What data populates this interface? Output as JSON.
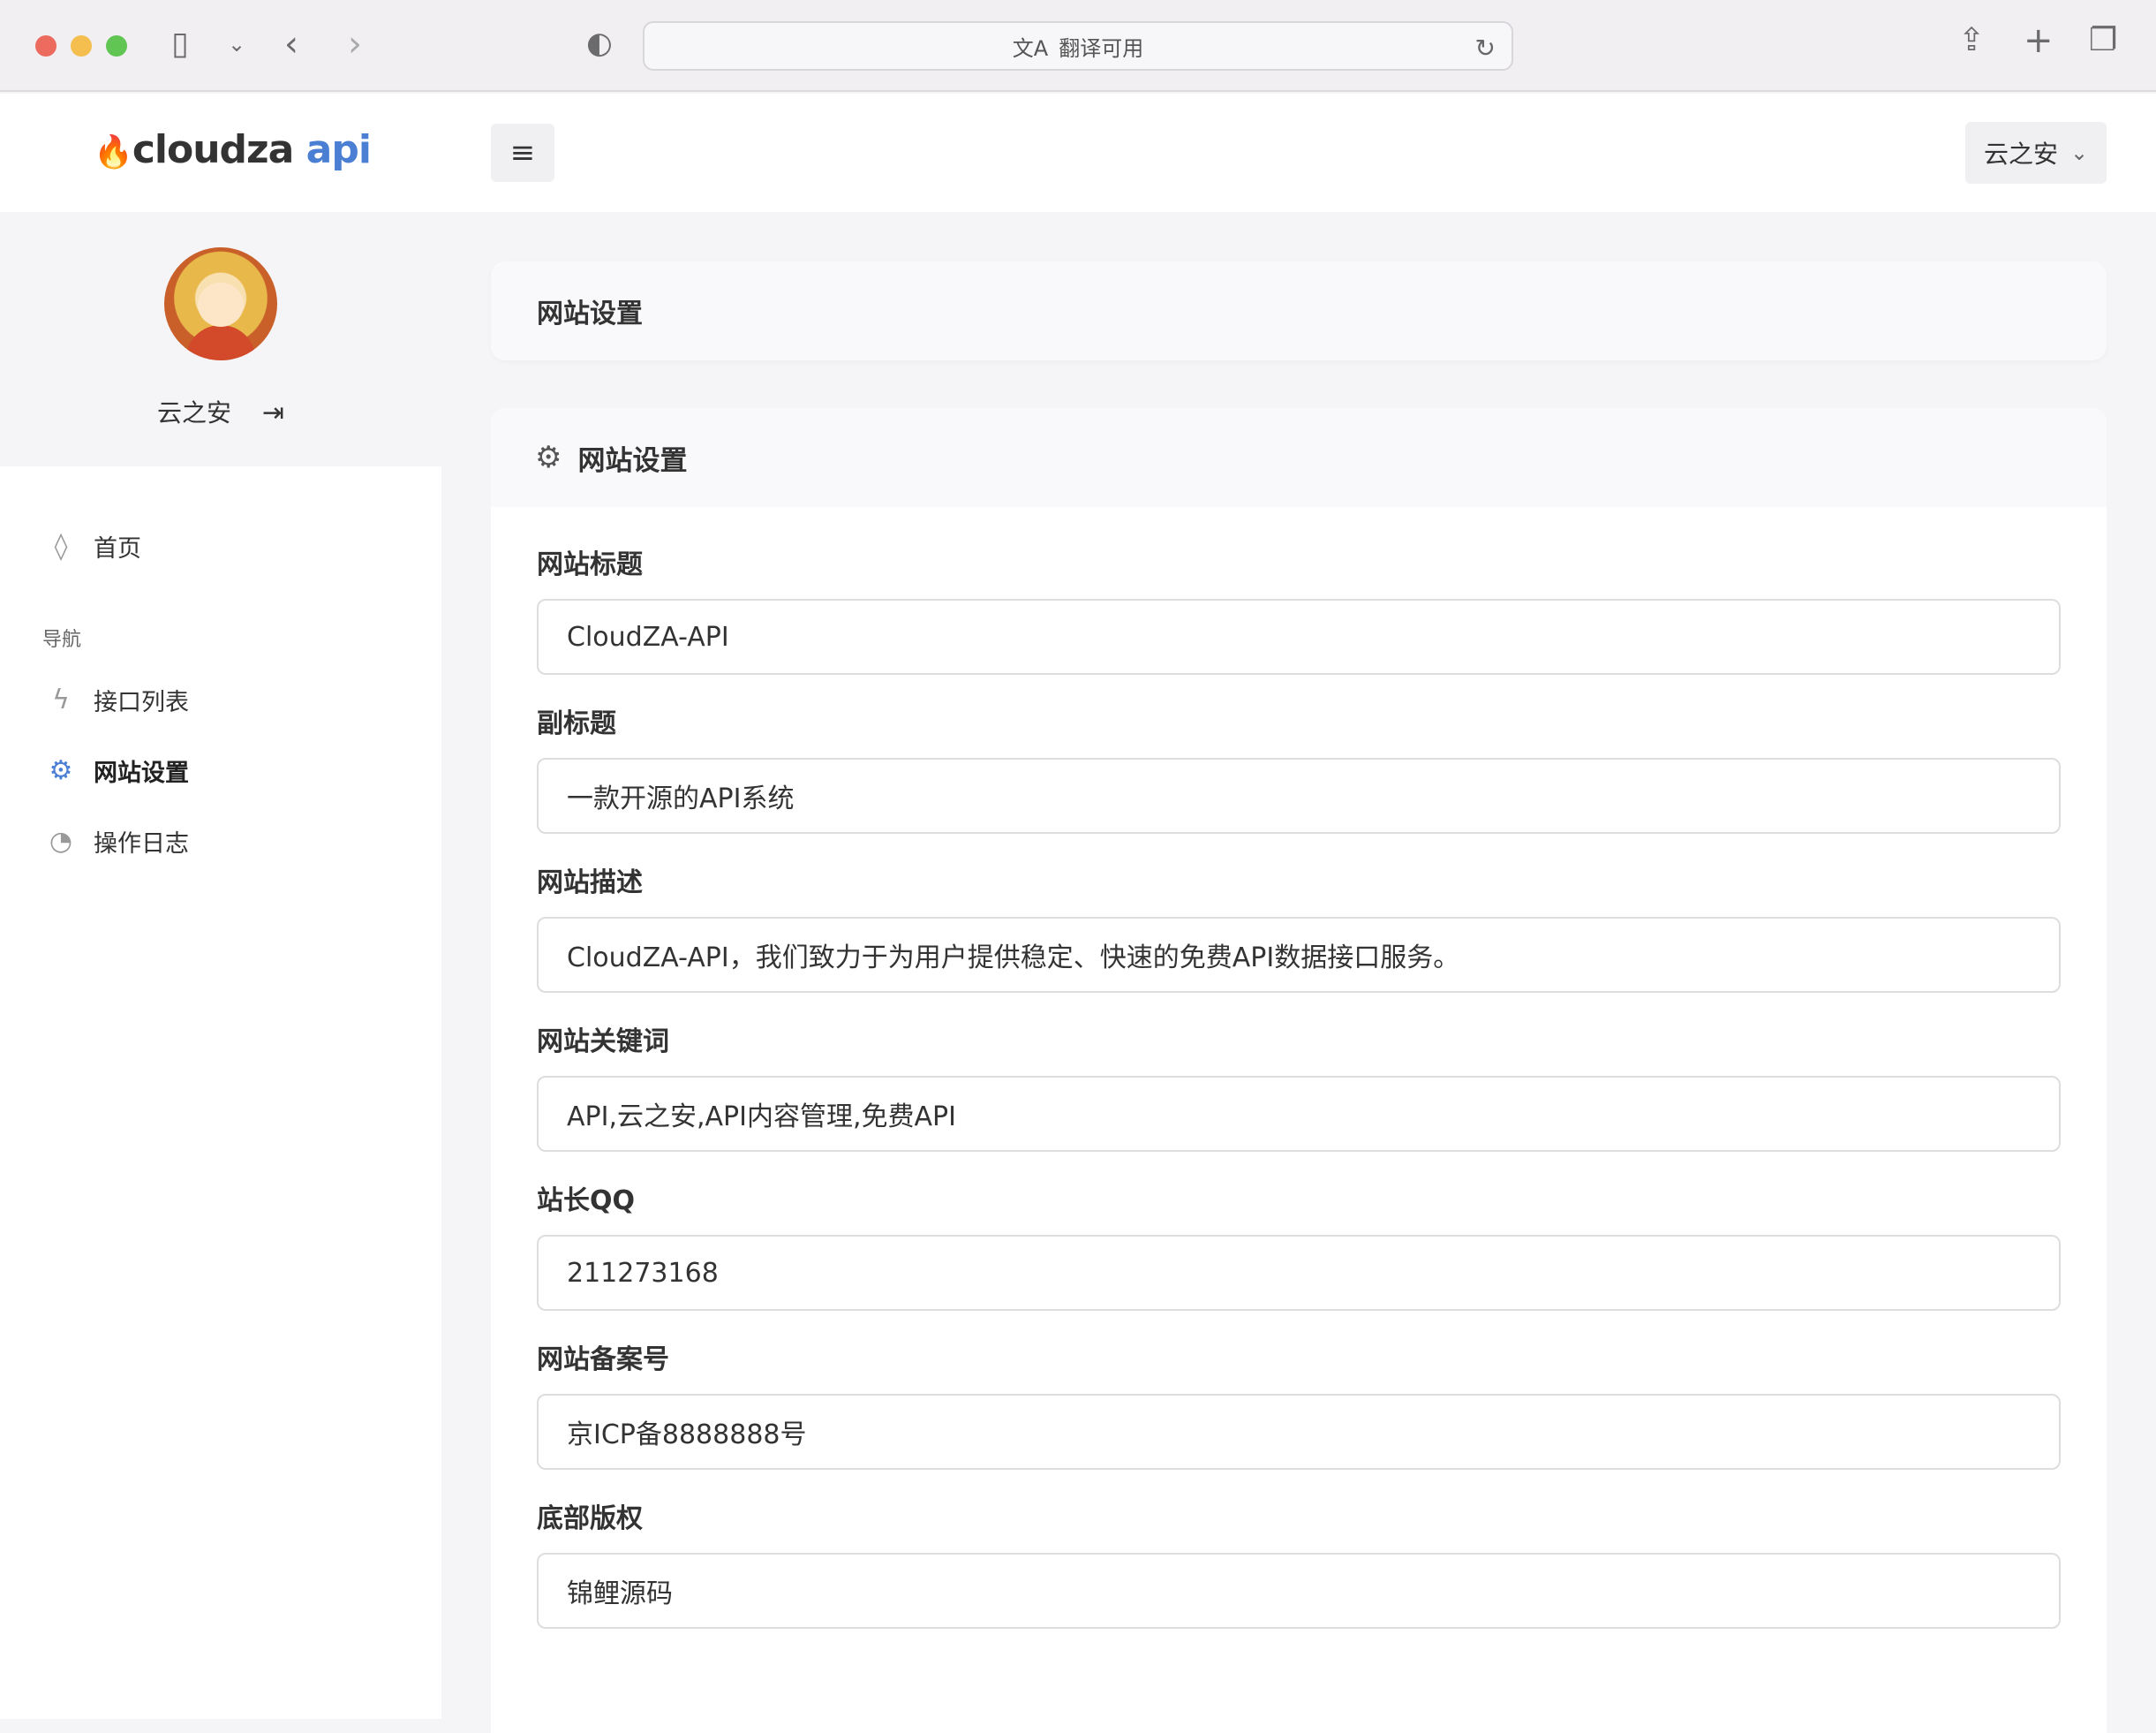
{
  "browser": {
    "url_text": "翻译可用",
    "translate_icon": "translate-icon",
    "reload_icon": "reload-icon"
  },
  "header": {
    "logo_main": "cloudza",
    "logo_accent": "api",
    "menu_icon": "≡",
    "user_name": "云之安",
    "accent_color": "#4a7fd4"
  },
  "sidebar": {
    "profile_name": "云之安",
    "logout_icon": "logout-icon",
    "home_label": "首页",
    "section_label": "导航",
    "items": [
      {
        "label": "接口列表",
        "icon": "bolt-icon"
      },
      {
        "label": "网站设置",
        "icon": "gear-icon",
        "active": true
      },
      {
        "label": "操作日志",
        "icon": "clock-icon"
      }
    ]
  },
  "main": {
    "page_title": "网站设置",
    "card_title": "网站设置",
    "fields": [
      {
        "label": "网站标题",
        "value": "CloudZA-API"
      },
      {
        "label": "副标题",
        "value": "一款开源的API系统"
      },
      {
        "label": "网站描述",
        "value": "CloudZA-API，我们致力于为用户提供稳定、快速的免费API数据接口服务。"
      },
      {
        "label": "网站关键词",
        "value": "API,云之安,API内容管理,免费API"
      },
      {
        "label": "站长QQ",
        "value": "211273168"
      },
      {
        "label": "网站备案号",
        "value": "京ICP备8888888号"
      },
      {
        "label": "底部版权",
        "value": "锦鲤源码"
      }
    ]
  }
}
